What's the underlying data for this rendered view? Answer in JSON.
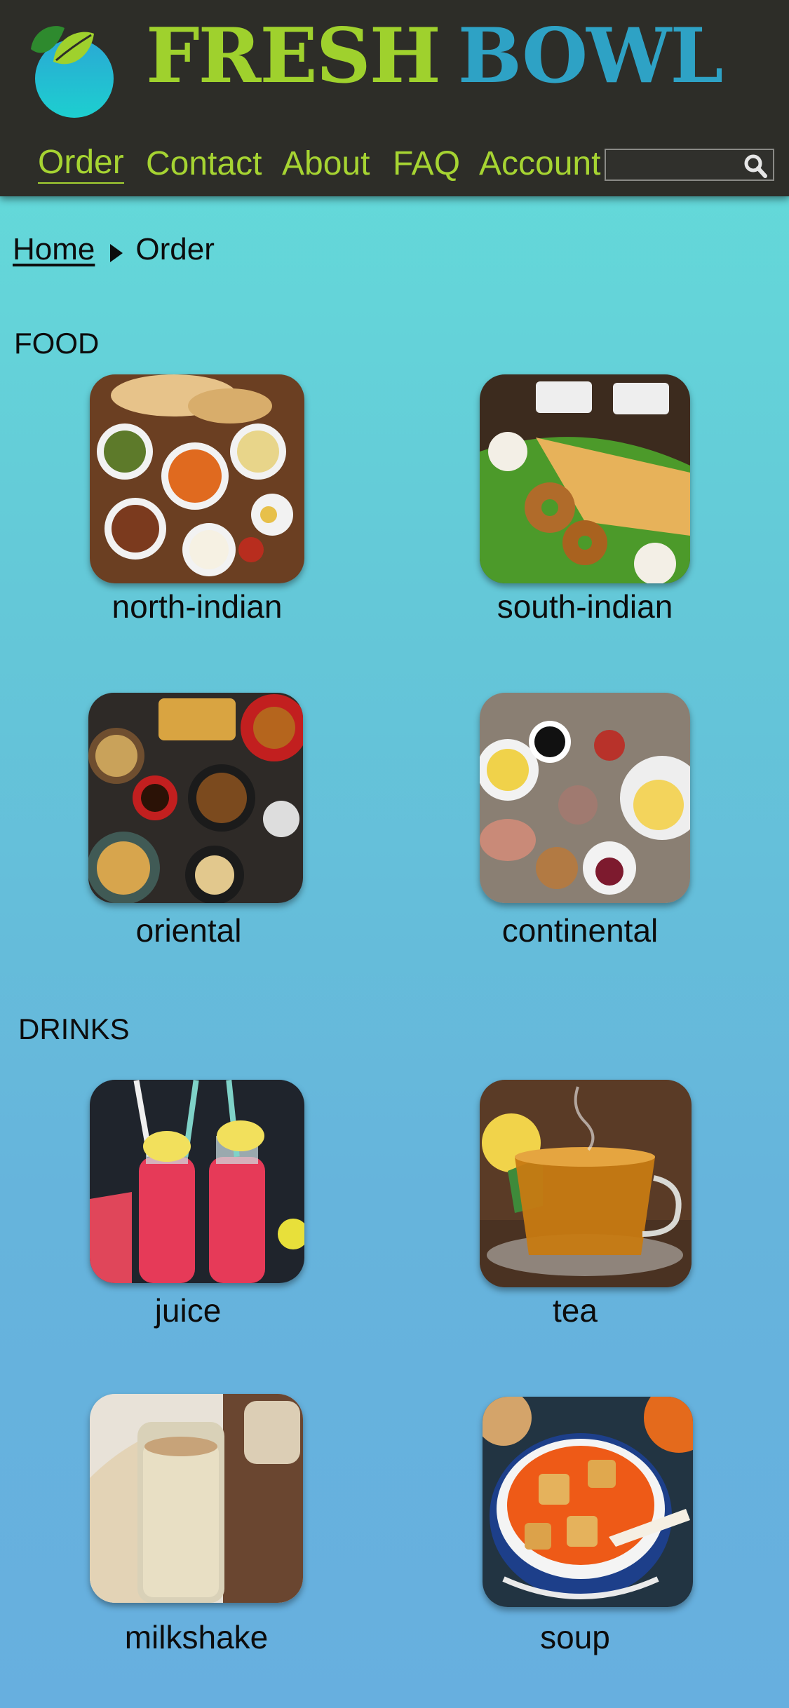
{
  "brand": {
    "word1": "FRESH",
    "word2": "BOWL",
    "logo_icon": "leaf-bowl-icon"
  },
  "nav": {
    "items": [
      {
        "label": "Order",
        "active": true
      },
      {
        "label": "Contact"
      },
      {
        "label": "About"
      },
      {
        "label": "FAQ"
      },
      {
        "label": "Account"
      }
    ],
    "search": {
      "value": "",
      "placeholder": "",
      "icon": "search-icon"
    }
  },
  "breadcrumb": {
    "home": "Home",
    "separator_icon": "chevron-right-icon",
    "current": "Order"
  },
  "sections": [
    {
      "title": "FOOD",
      "items": [
        {
          "label": "north-indian",
          "image": "north-indian-thali"
        },
        {
          "label": "south-indian",
          "image": "dosa-vada-platter"
        },
        {
          "label": "oriental",
          "image": "asian-dishes-spread"
        },
        {
          "label": "continental",
          "image": "breakfast-table"
        }
      ]
    },
    {
      "title": "DRINKS",
      "items": [
        {
          "label": "juice",
          "image": "watermelon-juice-bottles"
        },
        {
          "label": "tea",
          "image": "glass-tea-cup"
        },
        {
          "label": "milkshake",
          "image": "milkshake-glass"
        },
        {
          "label": "soup",
          "image": "tomato-soup-bowl"
        }
      ]
    }
  ],
  "colors": {
    "header_bg": "#2d2d28",
    "brand_green": "#9fd12d",
    "brand_blue": "#2ea2c5",
    "nav_text": "#a6d432",
    "page_gradient_top": "#63e0da",
    "page_gradient_bottom": "#67afdf"
  }
}
